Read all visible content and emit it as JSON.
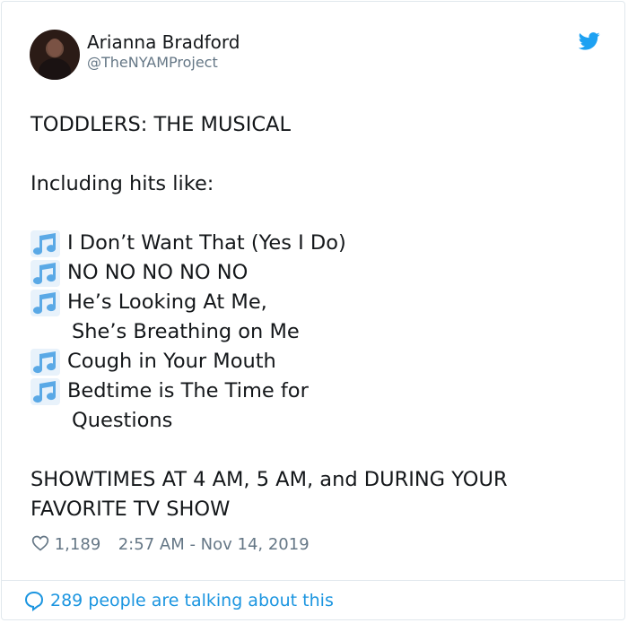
{
  "author": {
    "name": "Arianna Bradford",
    "handle": "@TheNYAMProject"
  },
  "tweet": {
    "title": "TODDLERS: THE MUSICAL",
    "intro": "Including hits like:",
    "songs": [
      {
        "text": "I Don’t Want That (Yes I Do)"
      },
      {
        "text": "NO NO NO NO NO"
      },
      {
        "text": "He’s Looking At Me,",
        "continuation": "She’s Breathing on Me"
      },
      {
        "text": "Cough in Your Mouth"
      },
      {
        "text": "Bedtime is The Time for",
        "continuation": "Questions"
      }
    ],
    "closing_line1": "SHOWTIMES AT 4 AM, 5 AM, and DURING YOUR",
    "closing_line2": "FAVORITE TV SHOW",
    "song_icon": "musical-note-icon"
  },
  "meta": {
    "likes": "1,189",
    "timestamp": "2:57 AM - Nov 14, 2019"
  },
  "footer": {
    "talking": "289 people are talking about this"
  },
  "colors": {
    "link": "#1b95e0",
    "twitter_blue": "#1da1f2",
    "note_blue": "#5aa9e6",
    "muted": "#657786",
    "text": "#14171a"
  }
}
